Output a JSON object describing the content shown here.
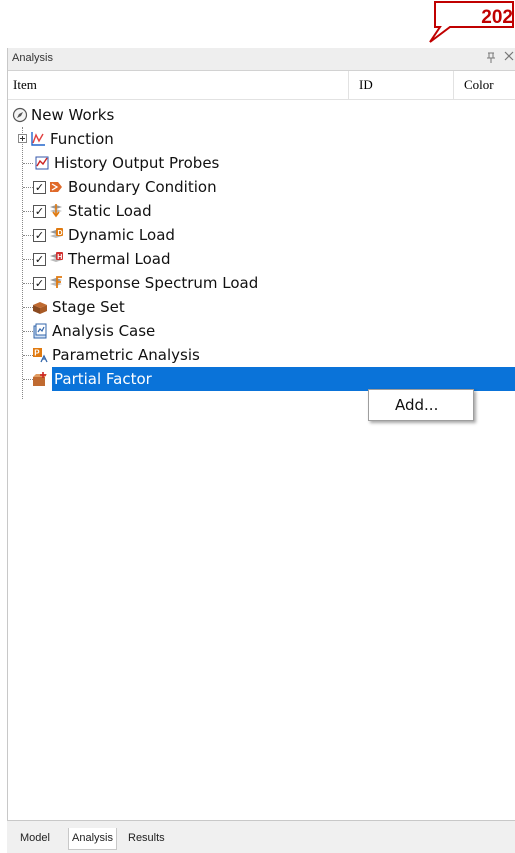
{
  "badge": {
    "number": "202",
    "border_color": "#c00000"
  },
  "panel": {
    "title": "Analysis",
    "pin_glyph": "Ẓ",
    "close_glyph": "×"
  },
  "columns": {
    "item": "Item",
    "id": "ID",
    "color": "Color"
  },
  "tree": {
    "root": {
      "label": "New Works",
      "icon": "compass-icon"
    },
    "items": [
      {
        "label": "Function",
        "icon": "function-graph-icon",
        "expandable": true
      },
      {
        "label": "History Output Probes",
        "icon": "probe-chart-icon"
      },
      {
        "label": "Boundary Condition",
        "icon": "boundary-condition-icon",
        "checked": true
      },
      {
        "label": "Static Load",
        "icon": "static-load-icon",
        "checked": true
      },
      {
        "label": "Dynamic Load",
        "icon": "dynamic-load-icon",
        "checked": true
      },
      {
        "label": "Thermal Load",
        "icon": "thermal-load-icon",
        "checked": true
      },
      {
        "label": "Response Spectrum Load",
        "icon": "response-spectrum-icon",
        "checked": true
      },
      {
        "label": "Stage Set",
        "icon": "stage-set-icon"
      },
      {
        "label": "Analysis Case",
        "icon": "analysis-case-icon"
      },
      {
        "label": "Parametric Analysis",
        "icon": "parametric-analysis-icon"
      },
      {
        "label": "Partial Factor",
        "icon": "partial-factor-icon",
        "selected": true
      }
    ],
    "check_mark": "✓"
  },
  "context_menu": {
    "items": [
      "Add..."
    ]
  },
  "bottom_tabs": {
    "tabs": [
      "Model",
      "Analysis",
      "Results"
    ],
    "active": "Analysis"
  },
  "colors": {
    "selection": "#0a73d9",
    "accent_red": "#c00000"
  }
}
